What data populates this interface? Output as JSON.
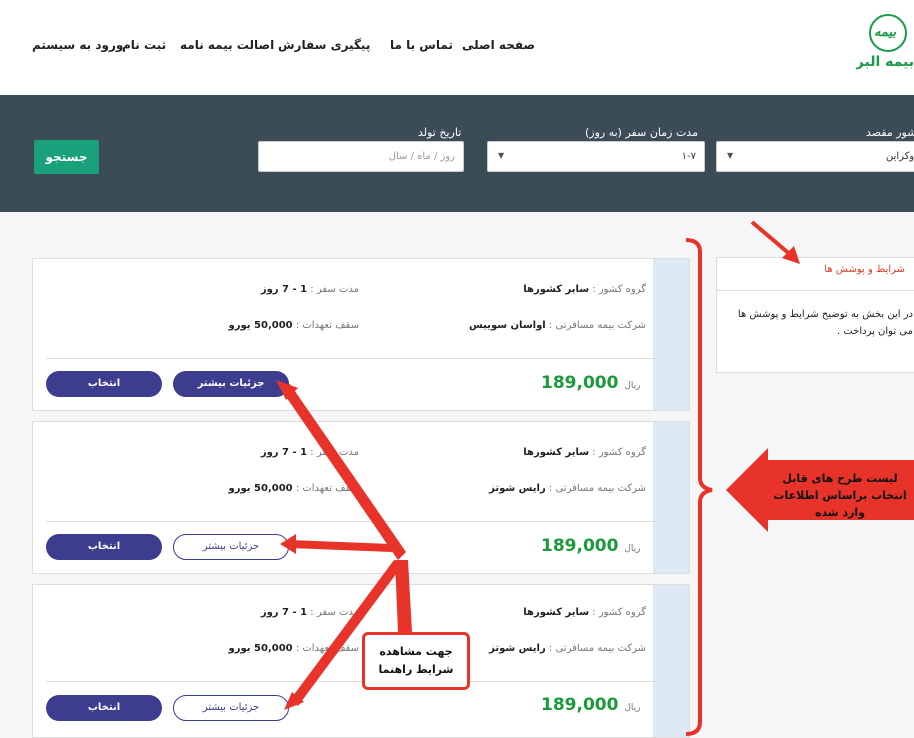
{
  "brand": {
    "logo_mark": "بیمه",
    "logo_text": "بیمه البرز",
    "color": "#1a9a4a"
  },
  "nav": {
    "items": [
      "صفحه اصلی",
      "تماس با ما",
      "پیگیری سفارش",
      "اصالت بیمه نامه",
      "ثبت نام",
      "ورود به سیستم"
    ]
  },
  "search": {
    "destination_label": "کشور مقصد",
    "destination_value": "اوکراین",
    "duration_label": "مدت زمان سفر (به روز)",
    "duration_value": "۱-۷",
    "birthdate_label": "تاریخ تولد",
    "birthdate_placeholder": "روز / ماه / سال",
    "search_button": "جستجو",
    "colors": {
      "bar": "#3c4c57",
      "button": "#1aa07a"
    }
  },
  "plans": [
    {
      "country_group_label": "گروه کشور :",
      "country_group": "سایر کشورها",
      "company_label": "شرکت بیمه مسافرتی :",
      "company": "اواسان سوییس",
      "duration_label": "مدت سفر :",
      "duration": "1 - 7 روز",
      "cover_label": "سقف تعهدات :",
      "cover": "50,000 یورو",
      "price": "189,000",
      "currency": "ریال",
      "details_button": "جزئیات بیشتر",
      "select_button": "انتخاب"
    },
    {
      "country_group_label": "گروه کشور :",
      "country_group": "سایر کشورها",
      "company_label": "شرکت بیمه مسافرتی :",
      "company": "رایس شوتز",
      "duration_label": "مدت سفر :",
      "duration": "1 - 7 روز",
      "cover_label": "سقف تعهدات :",
      "cover": "50,000 یورو",
      "price": "189,000",
      "currency": "ریال",
      "details_button": "جزئیات بیشتر",
      "select_button": "انتخاب"
    },
    {
      "country_group_label": "گروه کشور :",
      "country_group": "سایر کشورها",
      "company_label": "شرکت بیمه مسافرتی :",
      "company": "رایس شوتز",
      "duration_label": "مدت سفر :",
      "duration": "1 - 7 روز",
      "cover_label": "سقف تعهدات :",
      "cover": "50,000 یورو",
      "price": "189,000",
      "currency": "ریال",
      "details_button": "جزئیات بیشتر",
      "select_button": "انتخاب"
    }
  ],
  "terms": {
    "title": "شرایط و پوشش ها",
    "body": "در این بخش به توضیح شرایط و پوشش ها می توان پرداخت ."
  },
  "annotations": {
    "list_note": "لیست طرح های قابل انتخاب براساس اطلاعات وارد شده",
    "details_note_line1": "جهت مشاهده",
    "details_note_line2": "شرایط راهنما",
    "color": "#e8332a"
  }
}
